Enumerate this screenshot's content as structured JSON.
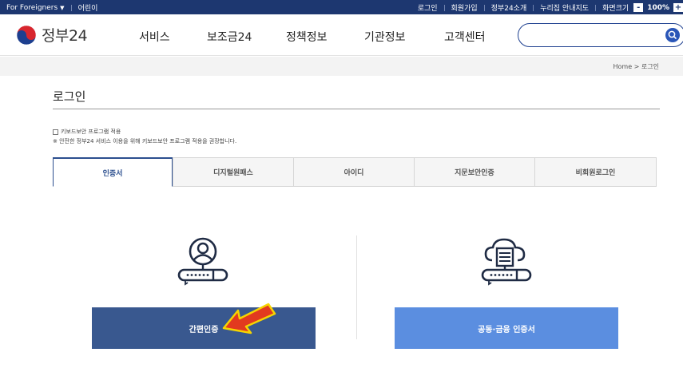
{
  "utility_bar": {
    "foreigners": "For Foreigners",
    "kids": "어린이",
    "login": "로그인",
    "signup": "회원가입",
    "about": "정부24소개",
    "sitemap": "누리집 안내지도",
    "screen_size": "화면크기",
    "zoom_minus": "-",
    "zoom_value": "100%",
    "zoom_plus": "+"
  },
  "header": {
    "logo_text": "정부24",
    "nav": [
      "서비스",
      "보조금24",
      "정책정보",
      "기관정보",
      "고객센터"
    ],
    "search_placeholder": ""
  },
  "breadcrumb": "Home > 로그인",
  "page": {
    "title": "로그인",
    "keyboard_security_label": "키보드보안 프로그램 적용",
    "keyboard_security_note": "※ 안전한 정부24 서비스 이용을 위해 키보드보안 프로그램 적용을 권장합니다."
  },
  "tabs": [
    "인증서",
    "디지털원패스",
    "아이디",
    "지문보안인증",
    "비회원로그인"
  ],
  "active_tab": "인증서",
  "auth_options": {
    "simple_auth_label": "간편인증",
    "joint_cert_label": "공동·금융 인증서"
  },
  "colors": {
    "topbar": "#1d3770",
    "simple_auth_button": "#39588f",
    "joint_cert_button": "#5b8ee0",
    "arrow": "#e23a1f"
  }
}
